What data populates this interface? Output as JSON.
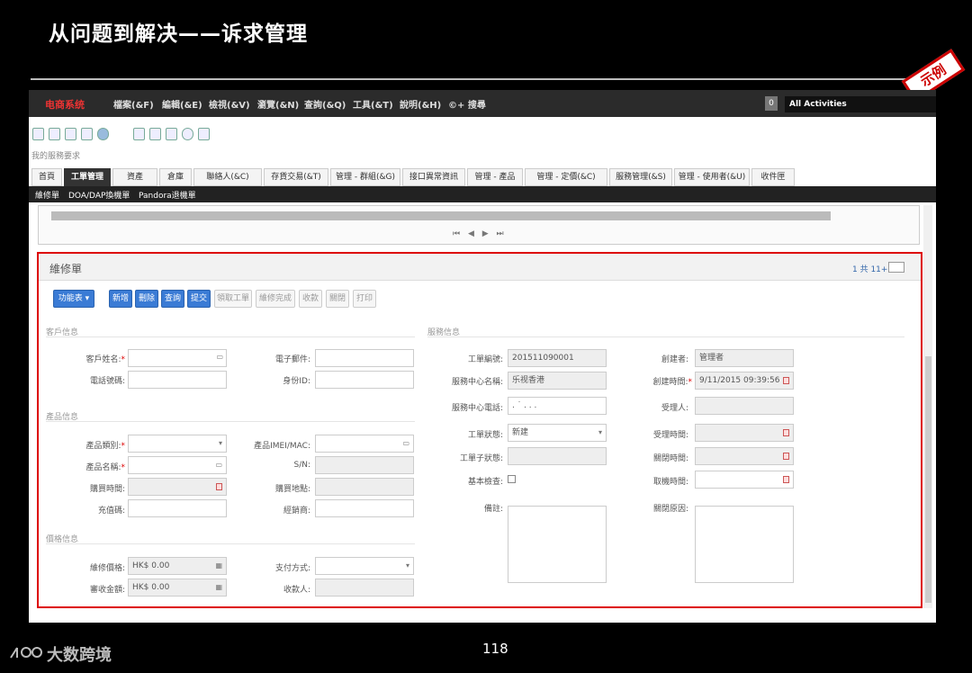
{
  "slide": {
    "title": "从问题到解决——诉求管理",
    "stamp": "示例",
    "page_number": "118",
    "footer_brand": "大数跨境"
  },
  "app": {
    "logo": "电商系统",
    "menu": [
      "檔案(&F)",
      "編輯(&E)",
      "檢視(&V)",
      "瀏覽(&N)",
      "查詢(&Q)",
      "工具(&T)",
      "說明(&H)",
      "©+ 搜尋"
    ],
    "counter": "0",
    "activities": "All Activities",
    "breadcrumb": "我的服務要求",
    "tabs": [
      "首頁",
      "工單管理",
      "資產",
      "倉庫",
      "聯絡人(&C)",
      "存貨交易(&T)",
      "管理 - 群組(&G)",
      "接口異常資訊",
      "管理 - 產品",
      "管理 - 定價(&C)",
      "服務管理(&S)",
      "管理 - 使用者(&U)",
      "收件匣"
    ],
    "subtabs": [
      "維修單",
      "DOA/DAP換機單",
      "Pandora退機單"
    ]
  },
  "form": {
    "title": "維修單",
    "count": "1 共 11+",
    "buttons": [
      "功能表 ▾",
      "新增",
      "刪除",
      "查詢",
      "提交",
      "領取工單",
      "維修完成",
      "收款",
      "關閉",
      "打印"
    ],
    "sections": {
      "customer": "客戶信息",
      "product": "產品信息",
      "price": "價格信息",
      "service": "服務信息"
    },
    "customer": {
      "name_label": "客戶姓名:",
      "name_value": "",
      "email_label": "電子郵件:",
      "email_value": "",
      "phone_label": "電話號碼:",
      "phone_value": "",
      "id_label": "身份ID:",
      "id_value": ""
    },
    "product": {
      "category_label": "產品類別:",
      "category_value": "",
      "imei_label": "產品IMEI/MAC:",
      "imei_value": "",
      "name_label": "產品名稱:",
      "name_value": "",
      "sn_label": "S/N:",
      "sn_value": "",
      "purchase_time_label": "購買時間:",
      "purchase_time_value": "",
      "purchase_place_label": "購買地點:",
      "purchase_place_value": "",
      "recharge_label": "充值碼:",
      "recharge_value": "",
      "dealer_label": "經銷商:",
      "dealer_value": ""
    },
    "price": {
      "repair_price_label": "維修價格:",
      "repair_price_value": "HK$ 0.00",
      "payment_label": "支付方式:",
      "payment_value": "",
      "receivable_label": "審收金額:",
      "receivable_value": "HK$ 0.00",
      "payee_label": "收款人:",
      "payee_value": ""
    },
    "service": {
      "ticket_no_label": "工單編號:",
      "ticket_no_value": "201511090001",
      "creator_label": "創建者:",
      "creator_value": "管理者",
      "center_name_label": "服務中心名稱:",
      "center_name_value": "乐视香港",
      "created_time_label": "創建時間:",
      "created_time_value": "9/11/2015 09:39:56",
      "center_phone_label": "服務中心電話:",
      "center_phone_value": ". ˙ . . .",
      "handler_label": "受理人:",
      "handler_value": "",
      "status_label": "工單狀態:",
      "status_value": "新建",
      "accept_time_label": "受理時間:",
      "accept_time_value": "",
      "substatus_label": "工單子狀態:",
      "substatus_value": "",
      "close_time_label": "關閉時間:",
      "close_time_value": "",
      "basic_check_label": "基本檢查:",
      "pickup_time_label": "取機時間:",
      "pickup_time_value": "",
      "remarks_label": "備註:",
      "close_reason_label": "關閉原因:"
    }
  }
}
